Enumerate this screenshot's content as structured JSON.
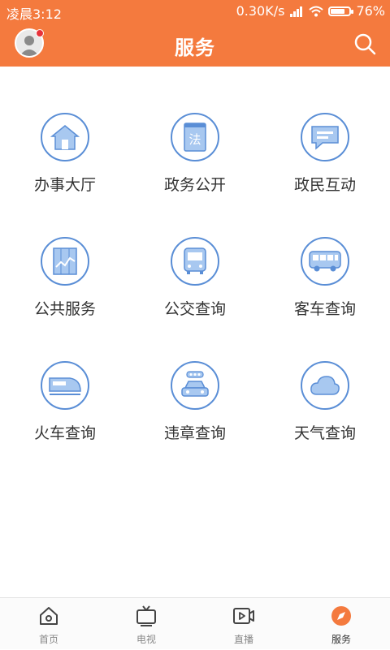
{
  "status_bar": {
    "time": "凌晨3:12",
    "network_speed": "0.30K/s",
    "battery": "76%",
    "battery_level": 0.76,
    "icons": [
      "signal-icon",
      "wifi-icon",
      "battery-icon"
    ]
  },
  "header": {
    "title": "服务",
    "avatar_icon": "avatar-icon",
    "search_icon": "search-icon",
    "color": "#f47a3e"
  },
  "services": [
    {
      "label": "办事大厅",
      "icon": "house-icon"
    },
    {
      "label": "政务公开",
      "icon": "law-book-icon"
    },
    {
      "label": "政民互动",
      "icon": "chat-bubble-icon"
    },
    {
      "label": "公共服务",
      "icon": "chart-board-icon"
    },
    {
      "label": "公交查询",
      "icon": "bus-front-icon"
    },
    {
      "label": "客车查询",
      "icon": "coach-bus-icon"
    },
    {
      "label": "火车查询",
      "icon": "train-icon"
    },
    {
      "label": "违章查询",
      "icon": "car-violation-icon"
    },
    {
      "label": "天气查询",
      "icon": "cloud-icon"
    }
  ],
  "tabs": [
    {
      "label": "首页",
      "icon": "home-icon",
      "active": false
    },
    {
      "label": "电视",
      "icon": "tv-icon",
      "active": false
    },
    {
      "label": "直播",
      "icon": "live-video-icon",
      "active": false
    },
    {
      "label": "服务",
      "icon": "compass-icon",
      "active": true
    }
  ],
  "colors": {
    "brand": "#f47a3e",
    "icon_stroke": "#5a8ed6",
    "icon_fill": "#a8c8f0"
  }
}
